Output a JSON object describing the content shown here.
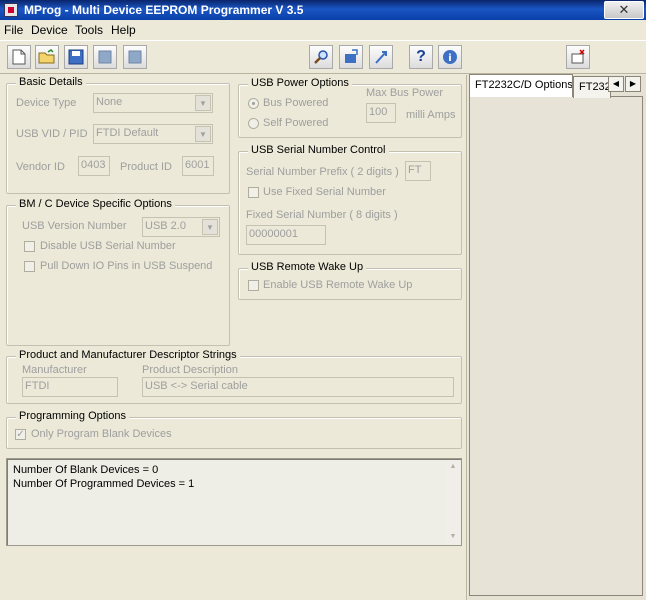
{
  "window": {
    "title": "MProg - Multi Device EEPROM Programmer V 3.5",
    "close_glyph": "✕"
  },
  "menu": [
    "File",
    "Device",
    "Tools",
    "Help"
  ],
  "toolbar": {
    "icons": [
      "new-file-icon",
      "open-folder-icon",
      "save-icon",
      "program-device-icon",
      "erase-device-icon",
      "scan-icon",
      "read-device-icon",
      "cycle-ports-icon",
      "help-icon",
      "about-icon",
      "close-device-icon"
    ],
    "help_glyph": "?",
    "info_glyph": "i"
  },
  "basic": {
    "title": "Basic Details",
    "device_type_label": "Device Type",
    "device_type_value": "None",
    "vidpid_label": "USB VID / PID",
    "vidpid_value": "FTDI Default",
    "vendor_label": "Vendor ID",
    "vendor_value": "0403",
    "product_label": "Product ID",
    "product_value": "6001"
  },
  "bmc": {
    "title": "BM / C Device Specific Options",
    "usb_version_label": "USB Version Number",
    "usb_version_value": "USB 2.0",
    "disable_serial": "Disable USB Serial Number",
    "pull_down": "Pull Down IO Pins in USB Suspend"
  },
  "power": {
    "title": "USB Power Options",
    "bus_powered": "Bus Powered",
    "self_powered": "Self Powered",
    "max_label": "Max Bus Power",
    "max_value": "100",
    "units": "milli Amps"
  },
  "serial": {
    "title": "USB Serial Number Control",
    "prefix_label": "Serial Number Prefix ( 2 digits )",
    "prefix_value": "FT",
    "use_fixed": "Use Fixed Serial Number",
    "fixed_label": "Fixed Serial Number ( 8 digits )",
    "fixed_value": "00000001"
  },
  "wake": {
    "title": "USB Remote Wake Up",
    "enable": "Enable USB Remote Wake Up"
  },
  "descriptors": {
    "title": "Product and Manufacturer Descriptor Strings",
    "manufacturer_label": "Manufacturer",
    "manufacturer_value": "FTDI",
    "product_label": "Product Description",
    "product_value": "USB <-> Serial cable"
  },
  "programming": {
    "title": "Programming Options",
    "only_blank": "Only Program Blank Devices"
  },
  "log": [
    "Number Of Blank Devices = 0",
    "Number Of Programmed Devices = 1"
  ],
  "tabs": [
    "FT2232C/D Options",
    "FT232"
  ],
  "tab_scroll": {
    "left": "◀",
    "right": "▶"
  },
  "glyphs": {
    "check": "✓",
    "combo_arrow": "▼",
    "scroll_up": "▲",
    "scroll_down": "▼"
  }
}
